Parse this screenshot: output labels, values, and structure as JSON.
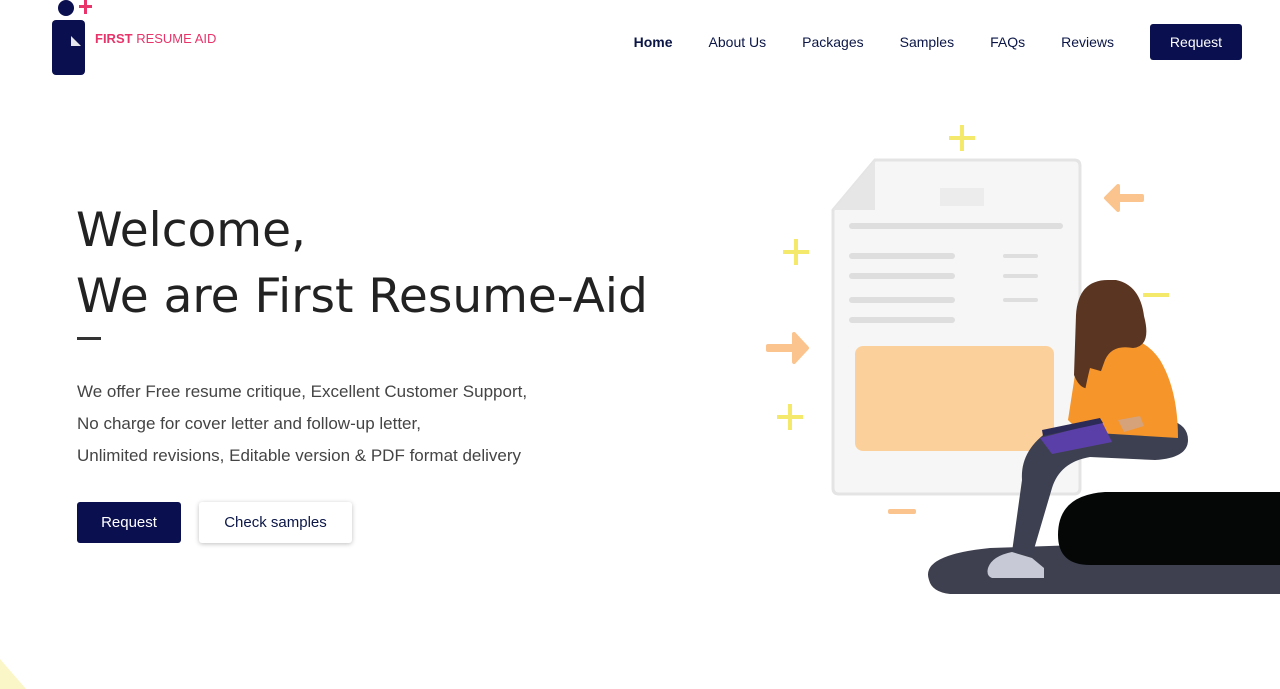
{
  "brand": {
    "name_bold": "FIRST",
    "name_light": "RESUME AID",
    "accent": "#e8346a",
    "navy": "#0a0f4f"
  },
  "nav": {
    "items": [
      {
        "label": "Home",
        "active": true
      },
      {
        "label": "About Us"
      },
      {
        "label": "Packages"
      },
      {
        "label": "Samples"
      },
      {
        "label": "FAQs"
      },
      {
        "label": "Reviews"
      }
    ],
    "cta": "Request"
  },
  "hero": {
    "title_line1": "Welcome,",
    "title_line2": "We are First Resume-Aid",
    "desc_line1": "We offer Free resume critique, Excellent Customer Support,",
    "desc_line2": "No charge for cover letter and follow-up letter,",
    "desc_line3": "Unlimited revisions, Editable version & PDF format delivery",
    "primary_button": "Request",
    "secondary_button": "Check samples"
  },
  "illustration": {
    "subject": "woman-with-laptop-reviewing-resume",
    "colors": {
      "yellow": "#f4e96b",
      "peach": "#fbc48e",
      "orange": "#f5952a",
      "hair": "#5a3522",
      "pants": "#3d4050",
      "seat": "#050707",
      "paper": "#f2f2f2",
      "laptop": "#5b3fa8"
    }
  }
}
